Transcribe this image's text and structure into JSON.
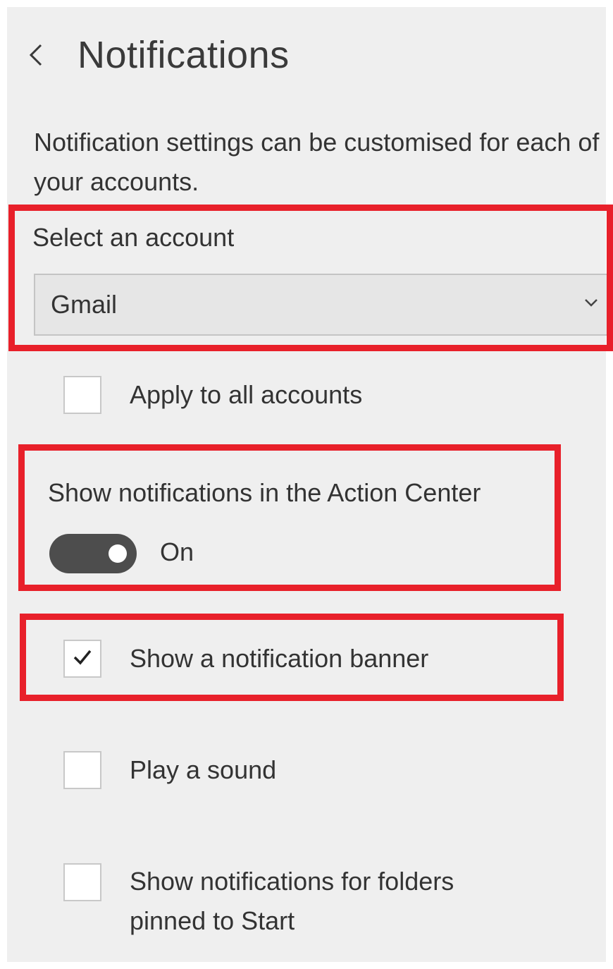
{
  "header": {
    "back_icon": "chevron-left-icon",
    "title": "Notifications"
  },
  "intro_text": "Notification settings can be customised for each of your accounts.",
  "account": {
    "label": "Select an account",
    "selected": "Gmail",
    "dropdown_icon": "chevron-down-icon"
  },
  "options": {
    "apply_all": {
      "label": "Apply to all accounts",
      "checked": false
    },
    "action_center": {
      "label": "Show notifications in the Action Center",
      "state": "On",
      "on": true
    },
    "banner": {
      "label": "Show a notification banner",
      "checked": true
    },
    "sound": {
      "label": "Play a sound",
      "checked": false
    },
    "pinned_folders": {
      "label": "Show notifications for folders pinned to Start",
      "checked": false
    }
  },
  "colors": {
    "highlight": "#e8202a",
    "panel_background": "#efefef",
    "toggle_on": "#4d4d4d"
  }
}
